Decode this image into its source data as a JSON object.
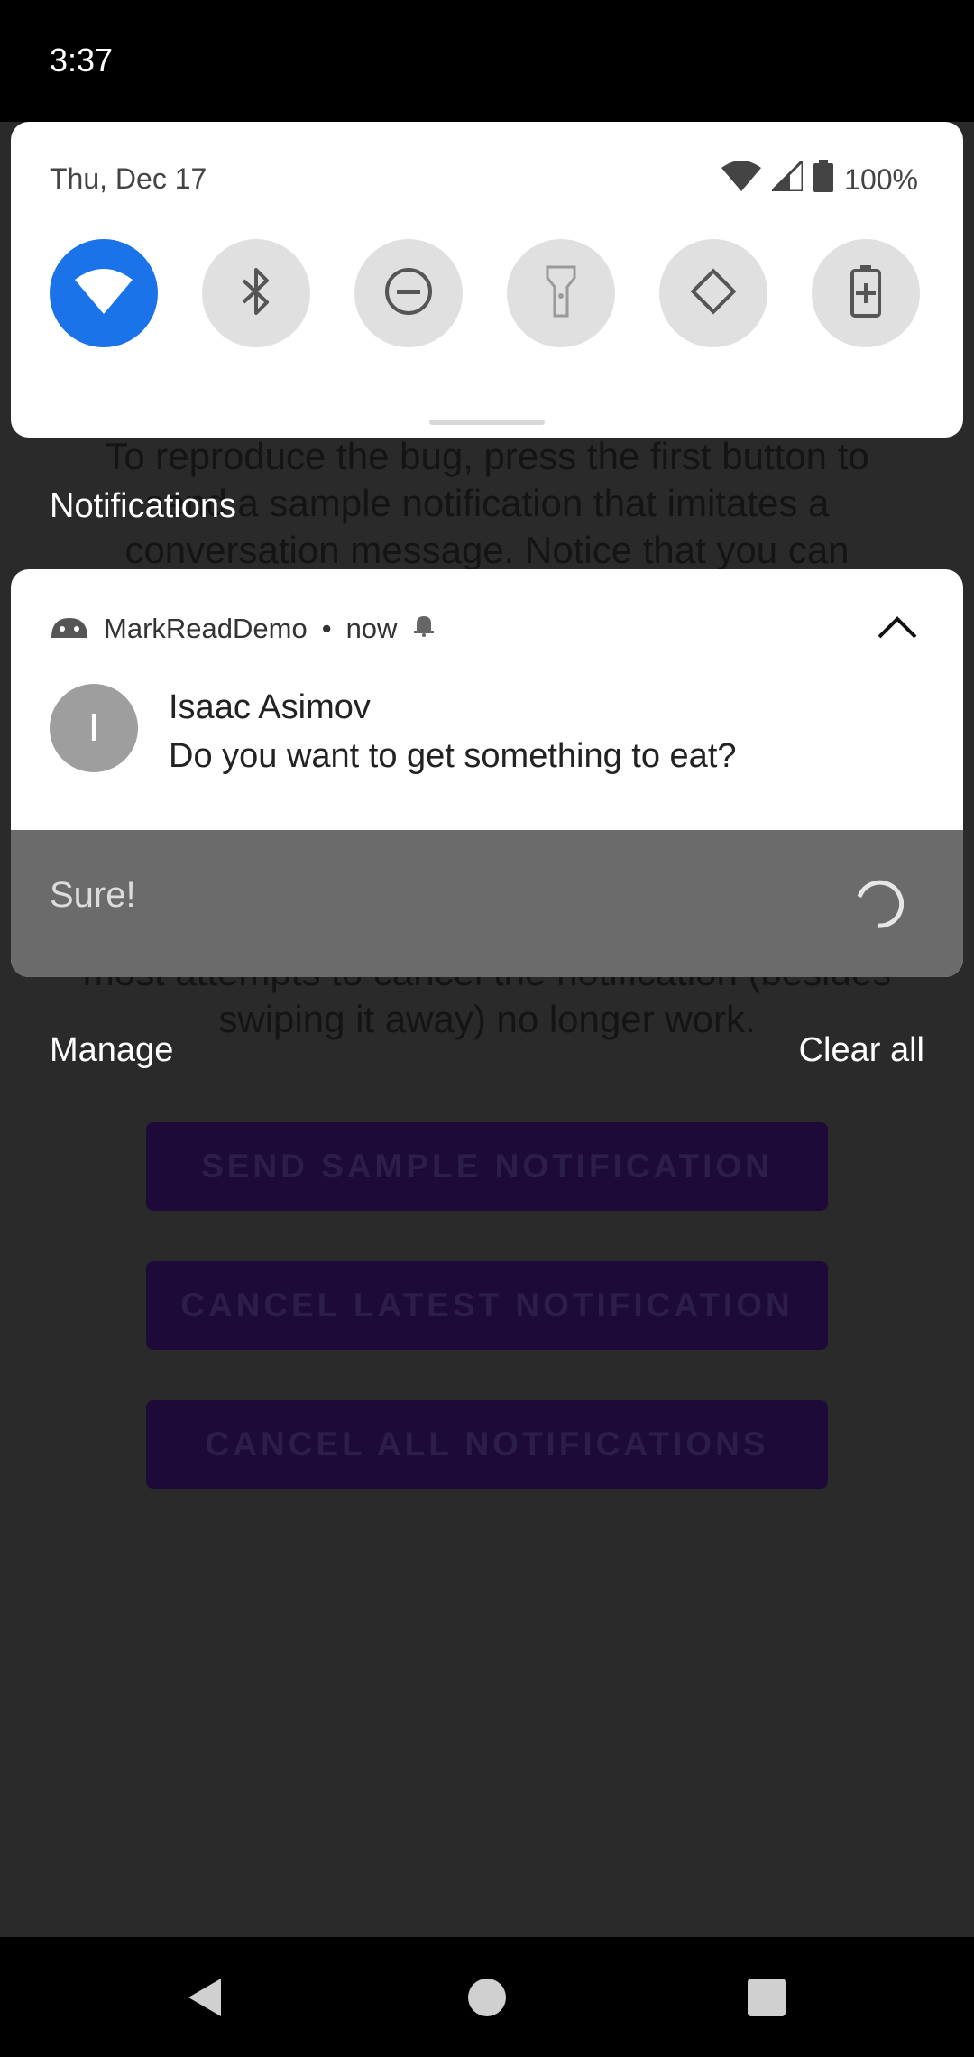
{
  "status_bar": {
    "time": "3:37"
  },
  "quick_settings": {
    "date": "Thu, Dec 17",
    "battery_percent": "100%",
    "tiles": [
      {
        "icon": "wifi-icon",
        "active": true
      },
      {
        "icon": "bluetooth-icon",
        "active": false
      },
      {
        "icon": "do-not-disturb-icon",
        "active": false
      },
      {
        "icon": "flashlight-icon",
        "active": false
      },
      {
        "icon": "auto-rotate-icon",
        "active": false
      },
      {
        "icon": "battery-saver-icon",
        "active": false
      }
    ]
  },
  "shade": {
    "notifications_label": "Notifications",
    "manage_label": "Manage",
    "clear_all_label": "Clear all"
  },
  "notification": {
    "app_name": "MarkReadDemo",
    "separator": "•",
    "time": "now",
    "avatar_initial": "I",
    "sender": "Isaac Asimov",
    "message": "Do you want to get something to eat?",
    "reply_text": "Sure!"
  },
  "app": {
    "text_top": "To reproduce the bug, press the first button to send a sample notification that imitates a conversation message. Notice that you can",
    "text_bottom": "most attempts to cancel the notification (besides swiping it away) no longer work.",
    "buttons": [
      "SEND SAMPLE NOTIFICATION",
      "CANCEL LATEST NOTIFICATION",
      "CANCEL ALL NOTIFICATIONS"
    ]
  },
  "colors": {
    "accent": "#1a73e8",
    "reply_area": "#6b6b6b",
    "app_button": "#1e0a38"
  }
}
